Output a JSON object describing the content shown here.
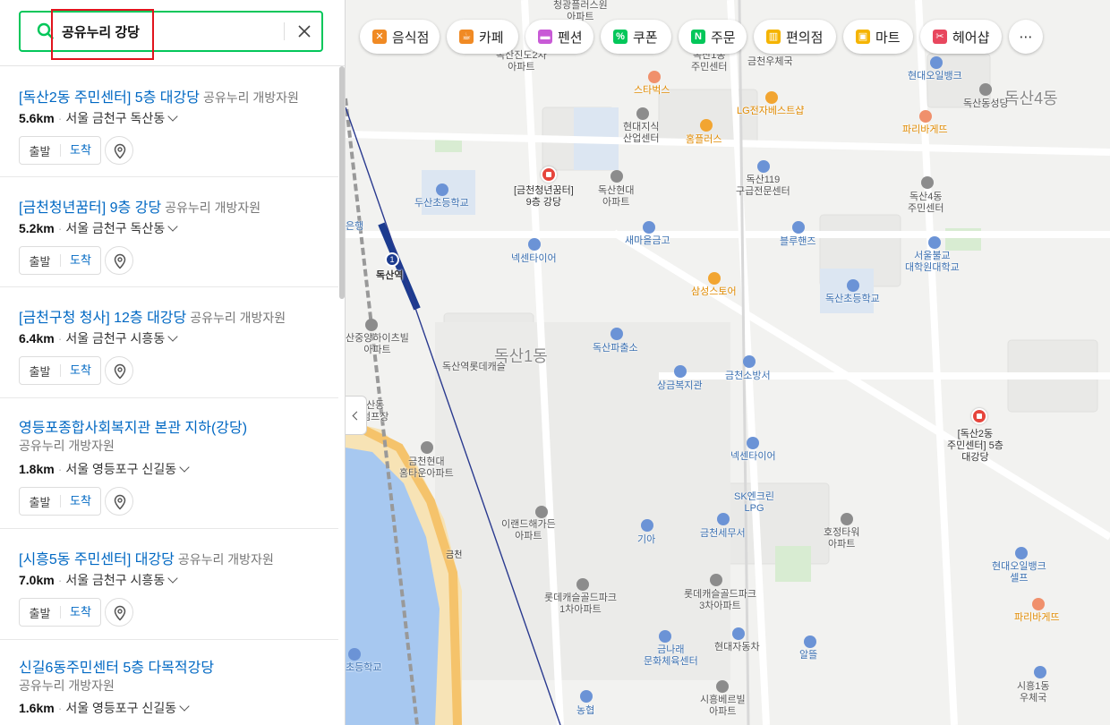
{
  "search": {
    "query": "공유누리 강당"
  },
  "results": [
    {
      "title": "[독산2동 주민센터] 5층 대강당",
      "category": "공유누리 개방자원",
      "distance": "5.6km",
      "address": "서울 금천구 독산동",
      "start": "출발",
      "arrive": "도착"
    },
    {
      "title": "[금천청년꿈터] 9층 강당",
      "category": "공유누리 개방자원",
      "distance": "5.2km",
      "address": "서울 금천구 독산동",
      "start": "출발",
      "arrive": "도착"
    },
    {
      "title": "[금천구청 청사] 12층 대강당",
      "category": "공유누리 개방자원",
      "distance": "6.4km",
      "address": "서울 금천구 시흥동",
      "start": "출발",
      "arrive": "도착"
    },
    {
      "title": "영등포종합사회복지관 본관 지하(강당)",
      "category": "공유누리 개방자원",
      "distance": "1.8km",
      "address": "서울 영등포구 신길동",
      "start": "출발",
      "arrive": "도착"
    },
    {
      "title": "[시흥5동 주민센터] 대강당",
      "category": "공유누리 개방자원",
      "distance": "7.0km",
      "address": "서울 금천구 시흥동",
      "start": "출발",
      "arrive": "도착"
    },
    {
      "title": "신길6동주민센터 5층 다목적강당",
      "category": "공유누리 개방자원",
      "distance": "1.6km",
      "address": "서울 영등포구 신길동"
    }
  ],
  "chips": [
    {
      "label": "음식점",
      "icon": "fork-knife-icon",
      "color": "#f08a24"
    },
    {
      "label": "카페",
      "icon": "coffee-cup-icon",
      "color": "#f08a24"
    },
    {
      "label": "펜션",
      "icon": "bed-icon",
      "color": "#c85ad6"
    },
    {
      "label": "쿠폰",
      "icon": "coupon-icon",
      "color": "#03c75a"
    },
    {
      "label": "주문",
      "icon": "naver-n-icon",
      "color": "#03c75a"
    },
    {
      "label": "편의점",
      "icon": "store-icon",
      "color": "#f5b400"
    },
    {
      "label": "마트",
      "icon": "cart-icon",
      "color": "#f5b400"
    },
    {
      "label": "헤어샵",
      "icon": "scissors-icon",
      "color": "#e8475e"
    },
    {
      "label": "⋯",
      "icon": "more-icon",
      "color": "#333333"
    }
  ],
  "map_labels": {
    "area_dongsan1": "독산1동",
    "area_dongsan4": "독산4동",
    "dongsan_station": "독산역",
    "pin_youth": "[금천청년꿈터]\n9층 강당",
    "pin_center2": "[독산2동\n주민센터] 5층\n대강당",
    "labels": [
      "청광플러스원\n아파트",
      "독산진도2차\n아파트",
      "독산1동\n주민센터",
      "금천우체국",
      "현대오일뱅크",
      "독산동성당",
      "스타벅스",
      "LG전자베스트샵",
      "파리바게뜨",
      "현대지식\n산업센터",
      "홈플러스",
      "독산현대\n아파트",
      "두산초등학교",
      "독산119\n구급전문센터",
      "독산4동\n주민센터",
      "새마을금고",
      "블루핸즈",
      "넥센타이어",
      "서울불교\n대학원대학교",
      "삼성스토어",
      "독산초등학교",
      "산중앙하이츠빌\n아파트",
      "독산파출소",
      "독산역롯데캐슬",
      "상금복지관",
      "금천소방서",
      "산동\n펌프장",
      "금천현대\n홈타운아파트",
      "넥센타이어",
      "SK엔크린\nLPG",
      "이랜드해가든\n아파트",
      "기아",
      "금천세무서",
      "호정타워\n아파트",
      "현대오일뱅크\n셀프",
      "롯데캐슬골드파크\n1차아파트",
      "롯데캐슬골드파크\n3차아파트",
      "금나래\n문화체육센터",
      "현대자동차",
      "알뜰",
      "파리바게뜨",
      "초등학교",
      "시흥베르빌\n아파트",
      "농협",
      "시흥1동\n우체국",
      "은행",
      "금천"
    ]
  },
  "colors": {
    "accent": "#03c75a",
    "link": "#0068c3",
    "highlight": "#e0141d"
  }
}
